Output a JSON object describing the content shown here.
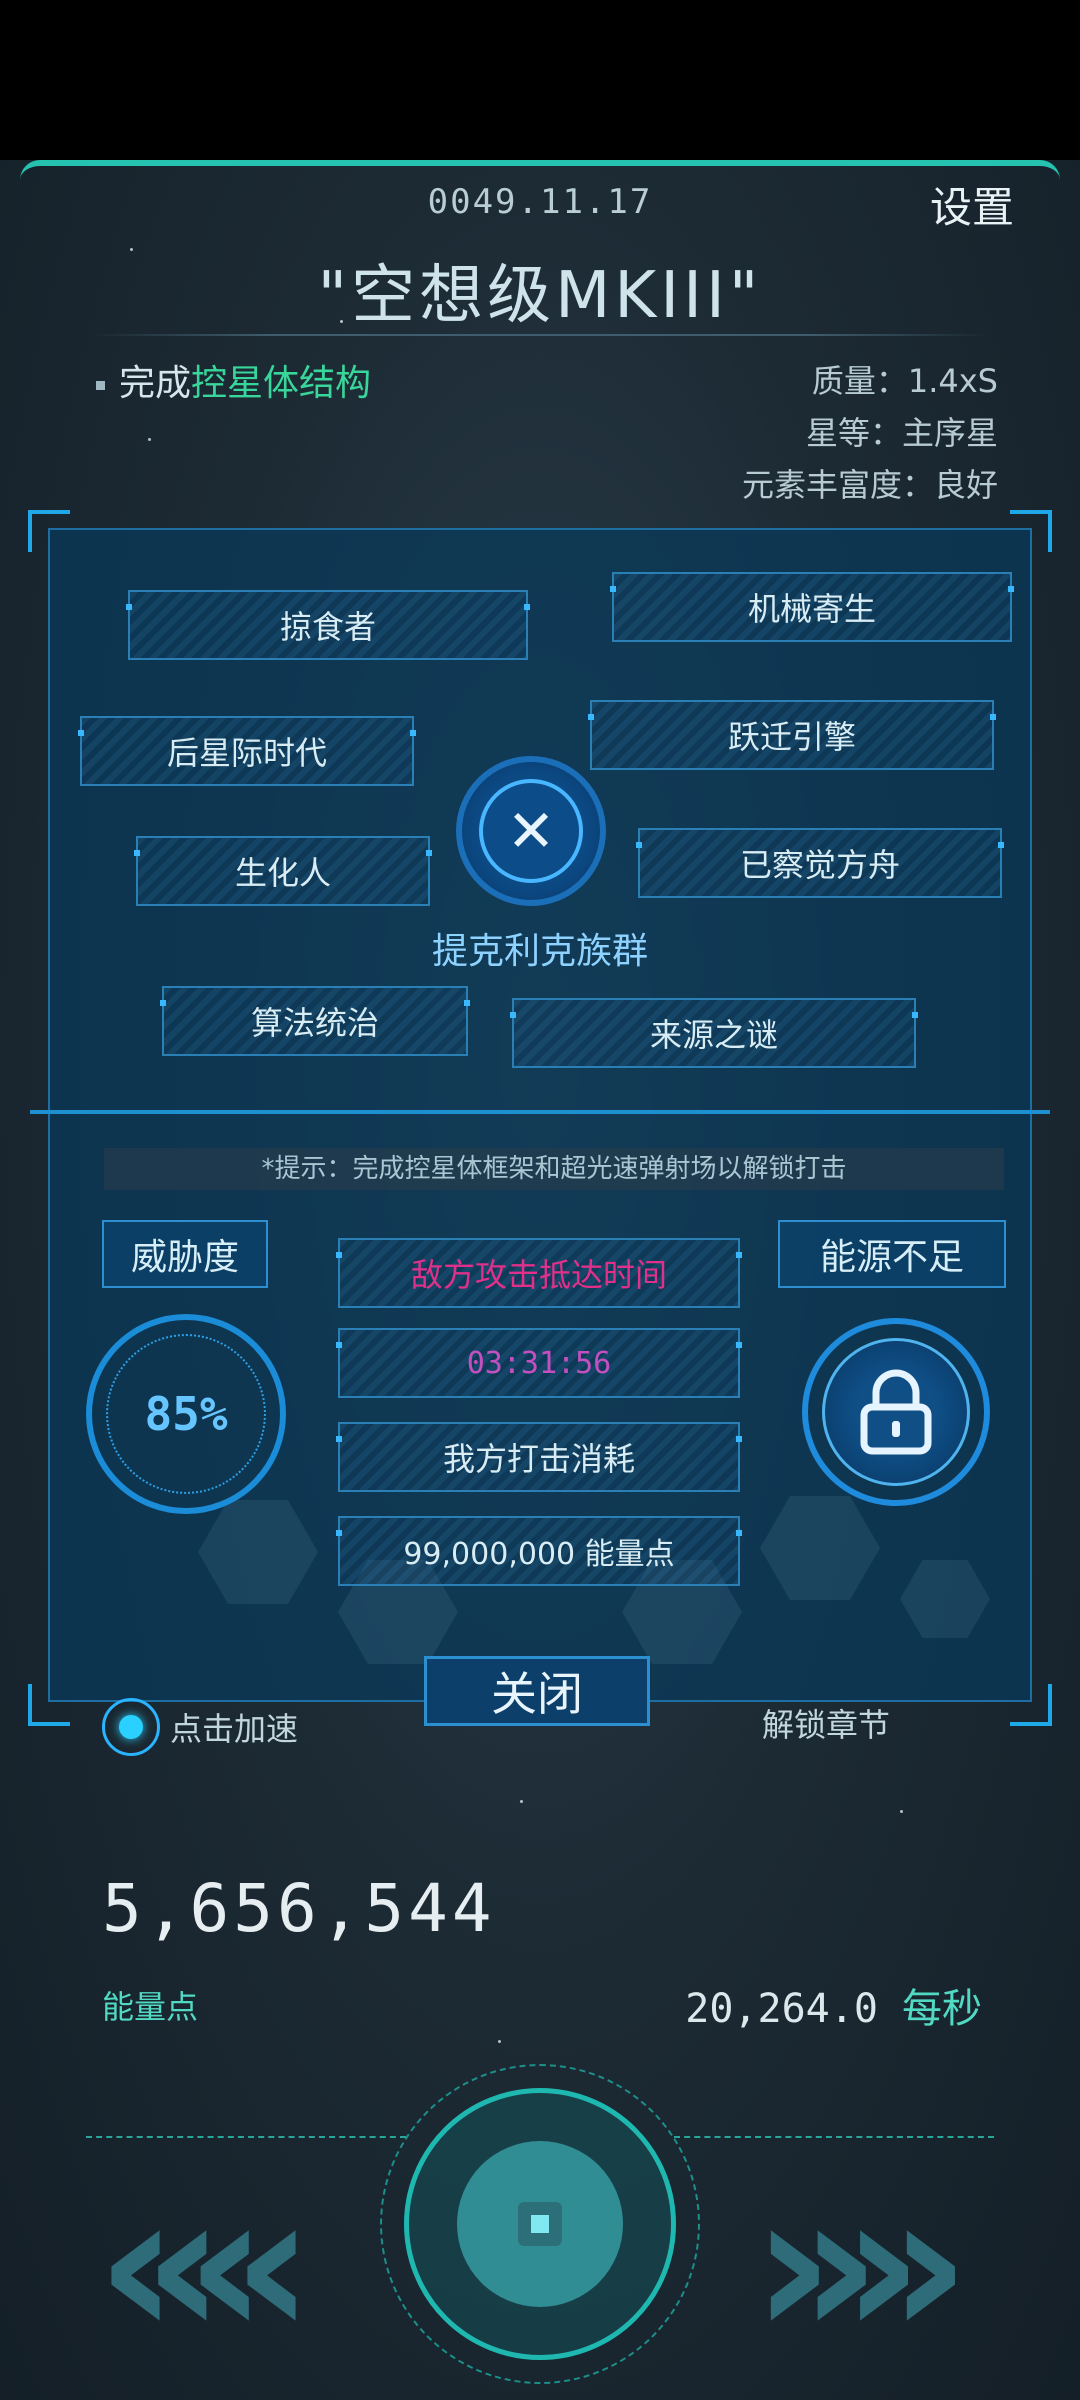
{
  "header": {
    "date": "0049.11.17",
    "settings_label": "设置",
    "title": "\"空想级MKIII\""
  },
  "task": {
    "prefix": "完成",
    "highlight": "控星体结构"
  },
  "star_info": {
    "mass": "质量：1.4xS",
    "star_class": "星等：主序星",
    "abundance": "元素丰富度：良好"
  },
  "tags": [
    "掠食者",
    "机械寄生",
    "后星际时代",
    "跃迁引擎",
    "生化人",
    "已察觉方舟",
    "算法统治",
    "来源之谜"
  ],
  "clan_name": "提克利克族群",
  "hint": "*提示：完成控星体框架和超光速弹射场以解锁打击",
  "threat": {
    "label": "威胁度",
    "value": "85%"
  },
  "energy_status": "能源不足",
  "attack": {
    "enemy_label": "敌方攻击抵达时间",
    "countdown": "03:31:56",
    "cost_label": "我方打击消耗",
    "cost_value": "99,000,000 能量点"
  },
  "close_label": "关闭",
  "speedup_label": "点击加速",
  "unlock_label": "解锁章节",
  "resources": {
    "energy_value": "5,656,544",
    "energy_label": "能量点",
    "rate_value": "20,264.0",
    "rate_unit": "每秒"
  },
  "colors": {
    "accent_teal": "#26c2b0",
    "panel_blue": "#083a5c",
    "highlight_green": "#39d69b",
    "enemy_pink": "#e0308a",
    "countdown_magenta": "#c34fc0"
  },
  "icons": [
    "lock-icon",
    "emblem-icon",
    "speed-dot-icon",
    "chevron-left-icon",
    "chevron-right-icon"
  ]
}
